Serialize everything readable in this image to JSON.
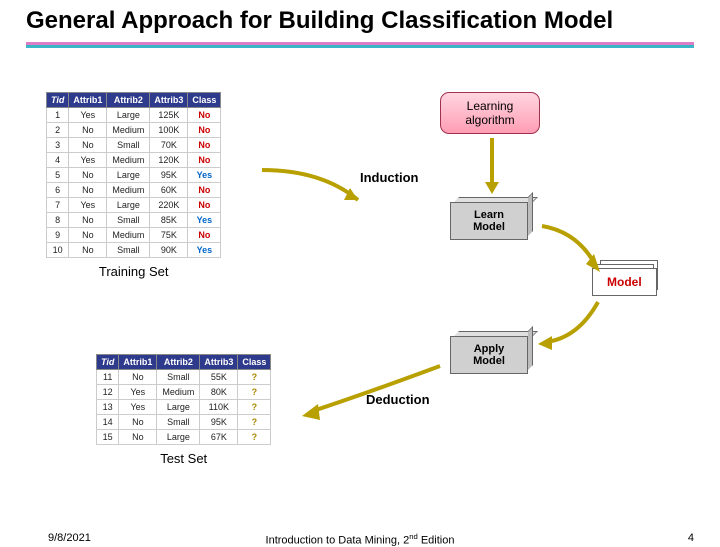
{
  "title": "General Approach for Building Classification Model",
  "training": {
    "caption": "Training Set",
    "headers": [
      "Tid",
      "Attrib1",
      "Attrib2",
      "Attrib3",
      "Class"
    ],
    "rows": [
      {
        "tid": "1",
        "a1": "Yes",
        "a2": "Large",
        "a3": "125K",
        "class": "No"
      },
      {
        "tid": "2",
        "a1": "No",
        "a2": "Medium",
        "a3": "100K",
        "class": "No"
      },
      {
        "tid": "3",
        "a1": "No",
        "a2": "Small",
        "a3": "70K",
        "class": "No"
      },
      {
        "tid": "4",
        "a1": "Yes",
        "a2": "Medium",
        "a3": "120K",
        "class": "No"
      },
      {
        "tid": "5",
        "a1": "No",
        "a2": "Large",
        "a3": "95K",
        "class": "Yes"
      },
      {
        "tid": "6",
        "a1": "No",
        "a2": "Medium",
        "a3": "60K",
        "class": "No"
      },
      {
        "tid": "7",
        "a1": "Yes",
        "a2": "Large",
        "a3": "220K",
        "class": "No"
      },
      {
        "tid": "8",
        "a1": "No",
        "a2": "Small",
        "a3": "85K",
        "class": "Yes"
      },
      {
        "tid": "9",
        "a1": "No",
        "a2": "Medium",
        "a3": "75K",
        "class": "No"
      },
      {
        "tid": "10",
        "a1": "No",
        "a2": "Small",
        "a3": "90K",
        "class": "Yes"
      }
    ]
  },
  "test": {
    "caption": "Test Set",
    "headers": [
      "Tid",
      "Attrib1",
      "Attrib2",
      "Attrib3",
      "Class"
    ],
    "rows": [
      {
        "tid": "11",
        "a1": "No",
        "a2": "Small",
        "a3": "55K",
        "class": "?"
      },
      {
        "tid": "12",
        "a1": "Yes",
        "a2": "Medium",
        "a3": "80K",
        "class": "?"
      },
      {
        "tid": "13",
        "a1": "Yes",
        "a2": "Large",
        "a3": "110K",
        "class": "?"
      },
      {
        "tid": "14",
        "a1": "No",
        "a2": "Small",
        "a3": "95K",
        "class": "?"
      },
      {
        "tid": "15",
        "a1": "No",
        "a2": "Large",
        "a3": "67K",
        "class": "?"
      }
    ]
  },
  "nodes": {
    "algorithm": "Learning algorithm",
    "learn": "Learn Model",
    "apply": "Apply Model",
    "model": "Model",
    "induction": "Induction",
    "deduction": "Deduction"
  },
  "footer": {
    "date": "9/8/2021",
    "mid_pre": "Introduction to Data Mining, 2",
    "mid_sup": "nd",
    "mid_post": " Edition",
    "page": "4"
  }
}
